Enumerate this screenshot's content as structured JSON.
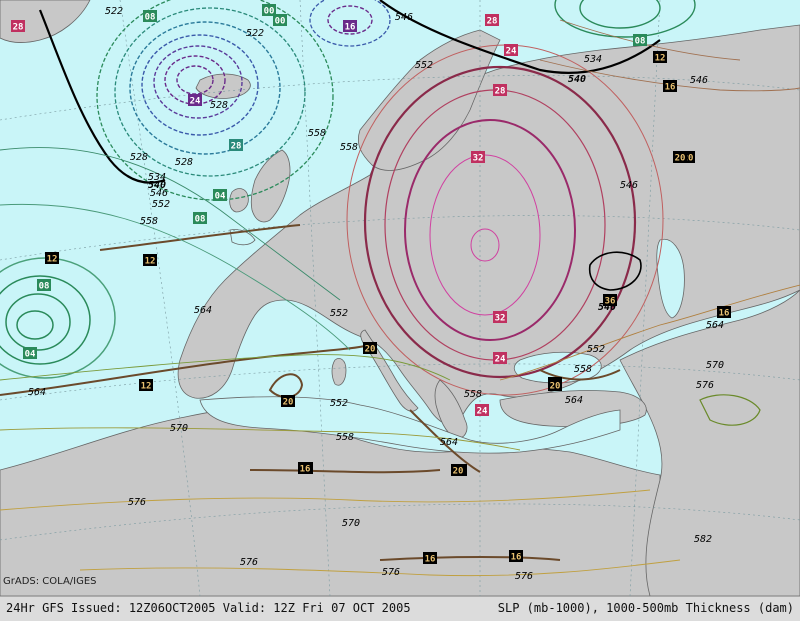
{
  "footer": {
    "left_text": "24Hr GFS Issued: 12Z06OCT2005 Valid: 12Z Fri 07 OCT 2005",
    "right_text": "SLP (mb-1000), 1000-500mb Thickness (dam)"
  },
  "credit": "GrADS: COLA/IGES",
  "colors": {
    "ocean": "#c9f5f8",
    "land": "#c8c8c8",
    "high_pressure": "#6b4a2b",
    "low_pressure_cold": "#2a8a5a",
    "low_pressure_deep": "#6a2a8a",
    "thickness_warm": "#8a2a4a",
    "thickness_line": "#000000",
    "coast": "#555555"
  },
  "thickness_labels": [
    "522",
    "522",
    "528",
    "528",
    "528",
    "534",
    "534",
    "540",
    "540",
    "540",
    "546",
    "546",
    "546",
    "546",
    "552",
    "552",
    "552",
    "552",
    "552",
    "558",
    "558",
    "558",
    "558",
    "558",
    "558",
    "564",
    "564",
    "564",
    "564",
    "564",
    "570",
    "570",
    "570",
    "576",
    "576",
    "576",
    "576",
    "576",
    "582"
  ],
  "pressure_boxes": [
    "28",
    "28",
    "28",
    "08",
    "12",
    "16",
    "20",
    "24",
    "24",
    "24",
    "12",
    "12",
    "08",
    "04",
    "04",
    "00",
    "00",
    "08",
    "08",
    "20",
    "20",
    "24",
    "28",
    "32",
    "32",
    "16",
    "16",
    "16",
    "20",
    "20",
    "12",
    "16",
    "16",
    "20",
    "16",
    "16",
    "24",
    "28",
    "16",
    "36",
    "16"
  ]
}
